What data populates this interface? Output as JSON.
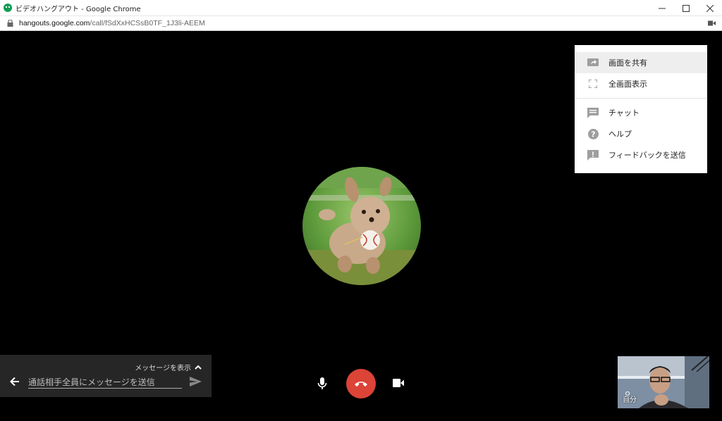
{
  "window": {
    "title": "ビデオハングアウト - Google Chrome"
  },
  "address": {
    "host": "hangouts.google.com",
    "path": "/call/fSdXxHCSsB0TF_1J3li-AEEM"
  },
  "menu": {
    "items": [
      {
        "label": "画面を共有",
        "icon": "screen-share-icon"
      },
      {
        "label": "全画面表示",
        "icon": "fullscreen-icon"
      },
      {
        "label": "チャット",
        "icon": "chat-icon"
      },
      {
        "label": "ヘルプ",
        "icon": "help-icon"
      },
      {
        "label": "フィードバックを送信",
        "icon": "feedback-icon"
      }
    ]
  },
  "chat": {
    "toggle_label": "メッセージを表示",
    "placeholder": "通話相手全員にメッセージを送信"
  },
  "self_view": {
    "label": "自分"
  },
  "colors": {
    "end_call": "#db4437",
    "app_icon": "#0f9d58"
  }
}
